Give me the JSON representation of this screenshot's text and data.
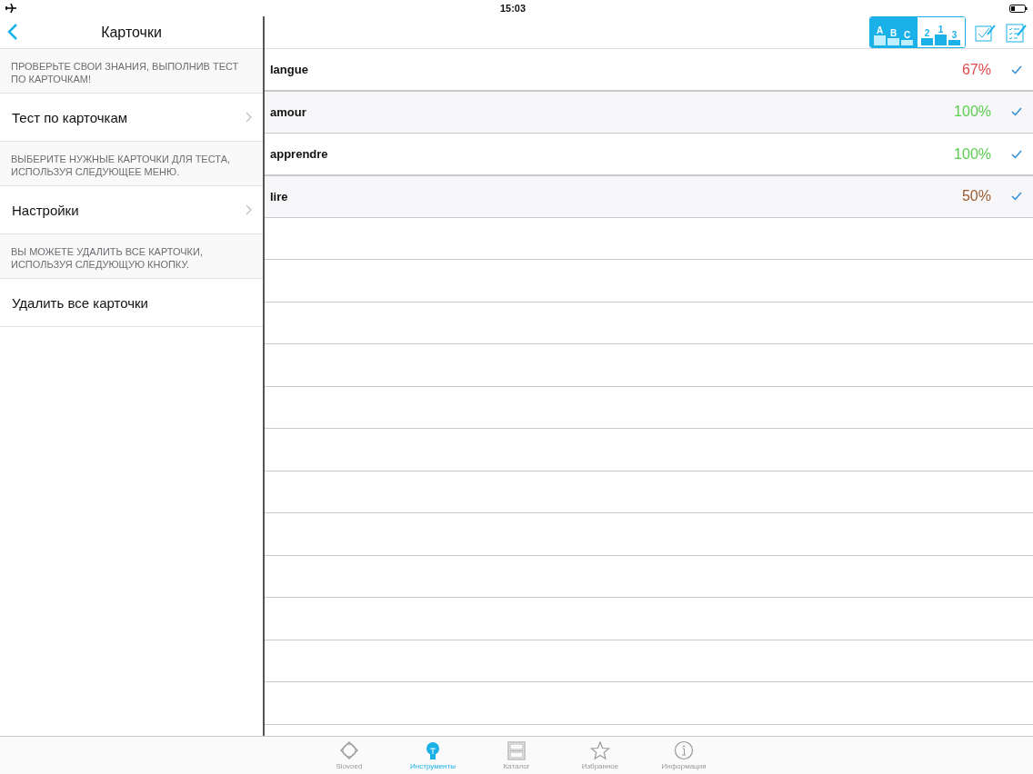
{
  "status_bar": {
    "time": "15:03"
  },
  "sidebar": {
    "title": "Карточки",
    "items": [
      {
        "kind": "note",
        "text": "ПРОВЕРЬТЕ СВОИ ЗНАНИЯ, ВЫПОЛНИВ ТЕСТ ПО КАРТОЧКАМ!"
      },
      {
        "kind": "cell",
        "text": "Тест по карточкам",
        "chevron": true
      },
      {
        "kind": "note",
        "text": "ВЫБЕРИТЕ НУЖНЫЕ КАРТОЧКИ ДЛЯ ТЕСТА, ИСПОЛЬЗУЯ СЛЕДУЮЩЕЕ МЕНЮ."
      },
      {
        "kind": "cell",
        "text": "Настройки",
        "chevron": true
      },
      {
        "kind": "note",
        "text": "ВЫ МОЖЕТЕ УДАЛИТЬ ВСЕ КАРТОЧКИ, ИСПОЛЬЗУЯ СЛЕДУЮЩУЮ КНОПКУ."
      },
      {
        "kind": "cell",
        "text": "Удалить все карточки",
        "chevron": false
      }
    ]
  },
  "toolbar": {
    "sort_buttons": [
      {
        "labels": [
          "A",
          "B",
          "C"
        ],
        "selected": true
      },
      {
        "labels": [
          "2",
          "1",
          "3"
        ],
        "selected": false
      }
    ]
  },
  "cards": [
    {
      "word": "langue",
      "score": "67%",
      "color": "#e0474c",
      "checked": true
    },
    {
      "word": "amour",
      "score": "100%",
      "color": "#5ccd4f",
      "checked": true
    },
    {
      "word": "apprendre",
      "score": "100%",
      "color": "#5ccd4f",
      "checked": true
    },
    {
      "word": "lire",
      "score": "50%",
      "color": "#9c5a2e",
      "checked": true
    }
  ],
  "tab_bar": [
    {
      "label": "Slovoed",
      "selected": false
    },
    {
      "label": "Инструменты",
      "selected": true
    },
    {
      "label": "Каталог",
      "selected": false
    },
    {
      "label": "Избранное",
      "selected": false
    },
    {
      "label": "Информация",
      "selected": false
    }
  ]
}
